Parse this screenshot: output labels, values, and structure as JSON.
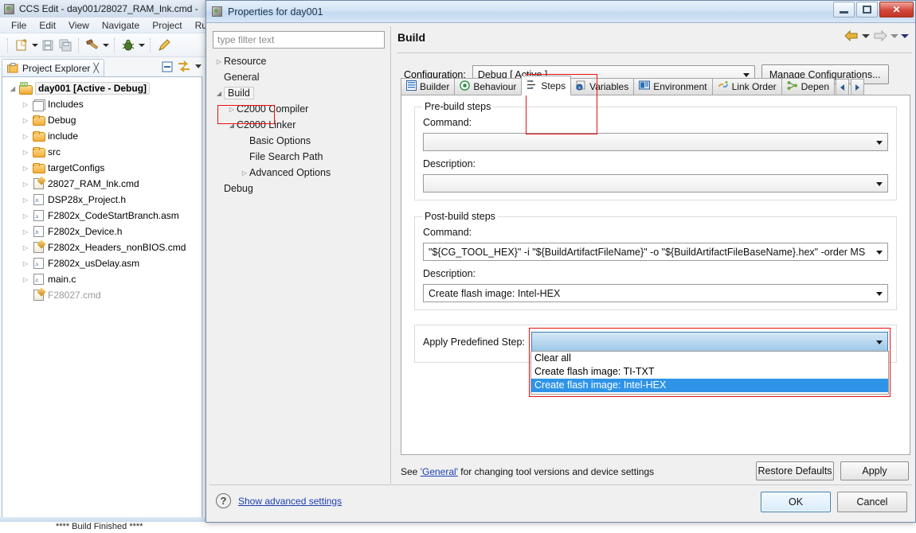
{
  "ide": {
    "title": "CCS Edit - day001/28027_RAM_lnk.cmd -",
    "menus": [
      "File",
      "Edit",
      "View",
      "Navigate",
      "Project",
      "Run"
    ],
    "view_tab": {
      "label": "Project Explorer",
      "close_glyph": "╳"
    },
    "tree": [
      {
        "label": "day001  [Active - Debug]",
        "icon": "ccs-project-icon",
        "indent": 0,
        "twisty": "◢",
        "root": true
      },
      {
        "label": "Includes",
        "icon": "includes-icon",
        "indent": 1,
        "twisty": "▷"
      },
      {
        "label": "Debug",
        "icon": "folder-icon",
        "indent": 1,
        "twisty": "▷"
      },
      {
        "label": "include",
        "icon": "folder-icon",
        "indent": 1,
        "twisty": "▷"
      },
      {
        "label": "src",
        "icon": "folder-icon",
        "indent": 1,
        "twisty": "▷"
      },
      {
        "label": "targetConfigs",
        "icon": "folder-icon",
        "indent": 1,
        "twisty": "▷"
      },
      {
        "label": "28027_RAM_lnk.cmd",
        "icon": "cmd-file-icon",
        "indent": 1,
        "twisty": "▷"
      },
      {
        "label": "DSP28x_Project.h",
        "icon": "h-file-icon",
        "indent": 1,
        "twisty": "▷",
        "ext": ".h"
      },
      {
        "label": "F2802x_CodeStartBranch.asm",
        "icon": "asm-file-icon",
        "indent": 1,
        "twisty": "▷",
        "ext": ".s"
      },
      {
        "label": "F2802x_Device.h",
        "icon": "h-file-icon",
        "indent": 1,
        "twisty": "▷",
        "ext": ".h"
      },
      {
        "label": "F2802x_Headers_nonBIOS.cmd",
        "icon": "cmd-file-icon",
        "indent": 1,
        "twisty": "▷"
      },
      {
        "label": "F2802x_usDelay.asm",
        "icon": "asm-file-icon",
        "indent": 1,
        "twisty": "▷",
        "ext": ".s"
      },
      {
        "label": "main.c",
        "icon": "c-file-icon",
        "indent": 1,
        "twisty": "▷",
        "ext": ".c"
      },
      {
        "label": "F28027.cmd",
        "icon": "cmd-file-icon",
        "indent": 1,
        "twisty": "",
        "dim": true
      }
    ],
    "console_text": "**** Build Finished ****"
  },
  "dialog": {
    "title": "Properties for day001",
    "window_buttons": {
      "minimize": "minimize-button",
      "maximize": "maximize-button",
      "close": "✕"
    },
    "filter_placeholder": "type filter text",
    "nav_tree": [
      {
        "label": "Resource",
        "indent": 0,
        "twisty": "▷"
      },
      {
        "label": "General",
        "indent": 0,
        "twisty": ""
      },
      {
        "label": "Build",
        "indent": 0,
        "twisty": "◢",
        "selected": true
      },
      {
        "label": "C2000 Compiler",
        "indent": 1,
        "twisty": "▷"
      },
      {
        "label": "C2000 Linker",
        "indent": 1,
        "twisty": "◢"
      },
      {
        "label": "Basic Options",
        "indent": 2,
        "twisty": ""
      },
      {
        "label": "File Search Path",
        "indent": 2,
        "twisty": ""
      },
      {
        "label": "Advanced Options",
        "indent": 2,
        "twisty": "▷"
      },
      {
        "label": "Debug",
        "indent": 0,
        "twisty": ""
      }
    ],
    "page_title": "Build",
    "configuration": {
      "label": "Configuration:",
      "value": "Debug  [ Active ]",
      "manage_button": "Manage Configurations..."
    },
    "tabs": [
      {
        "label": "Builder",
        "icon": "builder-icon",
        "active": false
      },
      {
        "label": "Behaviour",
        "icon": "behaviour-icon",
        "active": false
      },
      {
        "label": "Steps",
        "icon": "steps-icon",
        "active": true
      },
      {
        "label": "Variables",
        "icon": "variables-icon",
        "active": false
      },
      {
        "label": "Environment",
        "icon": "environment-icon",
        "active": false
      },
      {
        "label": "Link Order",
        "icon": "link-order-icon",
        "active": false
      },
      {
        "label": "Depen",
        "icon": "dependencies-icon",
        "active": false
      }
    ],
    "prebuild": {
      "group_title": "Pre-build steps",
      "command_label": "Command:",
      "command_value": "",
      "description_label": "Description:",
      "description_value": ""
    },
    "postbuild": {
      "group_title": "Post-build steps",
      "command_label": "Command:",
      "command_value": "\"${CG_TOOL_HEX}\" -i \"${BuildArtifactFileName}\" -o \"${BuildArtifactFileBaseName}.hex\" -order MS",
      "description_label": "Description:",
      "description_value": "Create flash image: Intel-HEX"
    },
    "apply_predefined": {
      "label": "Apply Predefined Step:",
      "value": "",
      "options": [
        "Clear all",
        "Create flash image: TI-TXT",
        "Create flash image: Intel-HEX"
      ],
      "selected_index": 2
    },
    "footer": {
      "note_prefix": "See ",
      "note_link": "'General'",
      "note_suffix": " for changing tool versions and device settings",
      "restore_defaults": "Restore Defaults",
      "apply": "Apply",
      "show_advanced": "Show advanced settings",
      "help_glyph": "?",
      "ok": "OK",
      "cancel": "Cancel"
    }
  },
  "colors": {
    "highlight_red": "#e8110f",
    "selection_blue": "#2f94e8",
    "link_blue": "#1a3fb0"
  }
}
